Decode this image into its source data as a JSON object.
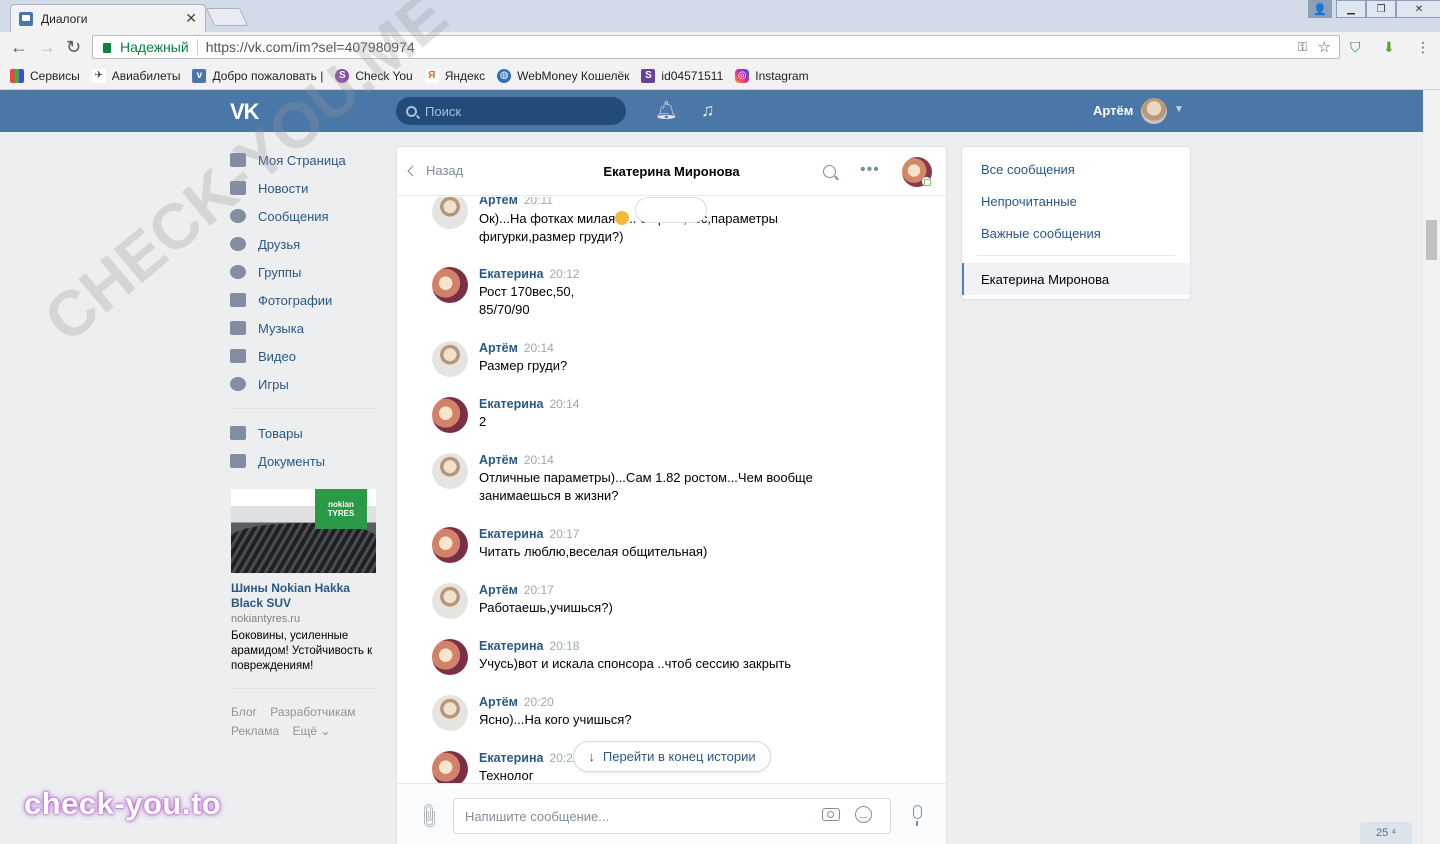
{
  "browser": {
    "tab_title": "Диалоги",
    "tab_close": "✕",
    "secure_label": "Надежный",
    "url": "https://vk.com/im?sel=407980974",
    "bookmarks": [
      "Сервисы",
      "Авиабилеты",
      "Добро пожаловать |",
      "Check You",
      "Яндекс",
      "WebMoney Кошелёк",
      "id04571511",
      "Instagram"
    ]
  },
  "header": {
    "logo": "VK",
    "search_placeholder": "Поиск",
    "user_name": "Артём"
  },
  "left_menu": {
    "items": [
      "Моя Страница",
      "Новости",
      "Сообщения",
      "Друзья",
      "Группы",
      "Фотографии",
      "Музыка",
      "Видео",
      "Игры"
    ],
    "items2": [
      "Товары",
      "Документы"
    ]
  },
  "ad": {
    "brand_line1": "nokian",
    "brand_line2": "TYRES",
    "title": "Шины Nokian Hakka Black SUV",
    "domain": "nokiantyres.ru",
    "text": "Боковины, усиленные арамидом! Устойчивость к повреждениям!"
  },
  "footer": {
    "links_row1": [
      "Блог",
      "Разработчикам"
    ],
    "links_row2": [
      "Реклама",
      "Ещё ⌄"
    ]
  },
  "chat": {
    "back_label": "Назад",
    "peer_name": "Екатерина Миронова",
    "jump_label": "Перейти в конец истории",
    "composer_placeholder": "Напишите сообщение...",
    "messages": [
      {
        "author": "Артём",
        "time": "20:11",
        "text_a": "Ок)...На фотках милая",
        "text_b": "..  бя рост,вес,параметры\nфигурки,размер груди?)",
        "who": "artem"
      },
      {
        "author": "Екатерина",
        "time": "20:12",
        "text": "Рост 170вес,50,\n85/70/90",
        "who": "kate"
      },
      {
        "author": "Артём",
        "time": "20:14",
        "text": "Размер груди?",
        "who": "artem"
      },
      {
        "author": "Екатерина",
        "time": "20:14",
        "text": "2",
        "who": "kate"
      },
      {
        "author": "Артём",
        "time": "20:14",
        "text": "Отличные параметры)...Сам 1.82 ростом...Чем вообще\nзанимаешься в жизни?",
        "who": "artem"
      },
      {
        "author": "Екатерина",
        "time": "20:17",
        "text": "Читать люблю,веселая общительная)",
        "who": "kate"
      },
      {
        "author": "Артём",
        "time": "20:17",
        "text": "Работаешь,учишься?)",
        "who": "artem"
      },
      {
        "author": "Екатерина",
        "time": "20:18",
        "text": "Учусь)вот и искала спонсора ..чтоб сессию закрыть",
        "who": "kate"
      },
      {
        "author": "Артём",
        "time": "20:20",
        "text": "Ясно)...На кого учишься?",
        "who": "artem"
      },
      {
        "author": "Екатерина",
        "time": "20:22",
        "text": "Технолог",
        "who": "kate"
      }
    ]
  },
  "right_menu": {
    "all": "Все сообщения",
    "unread": "Непрочитанные",
    "important": "Важные сообщения",
    "active": "Екатерина Миронова"
  },
  "counter": "25 ⁴",
  "watermark": {
    "big": "CHECK-YOU.ME",
    "brand": "check-you.to"
  },
  "colors": {
    "vk_header": "#4a76a8",
    "link": "#2a5885",
    "secure": "#0b8043"
  }
}
